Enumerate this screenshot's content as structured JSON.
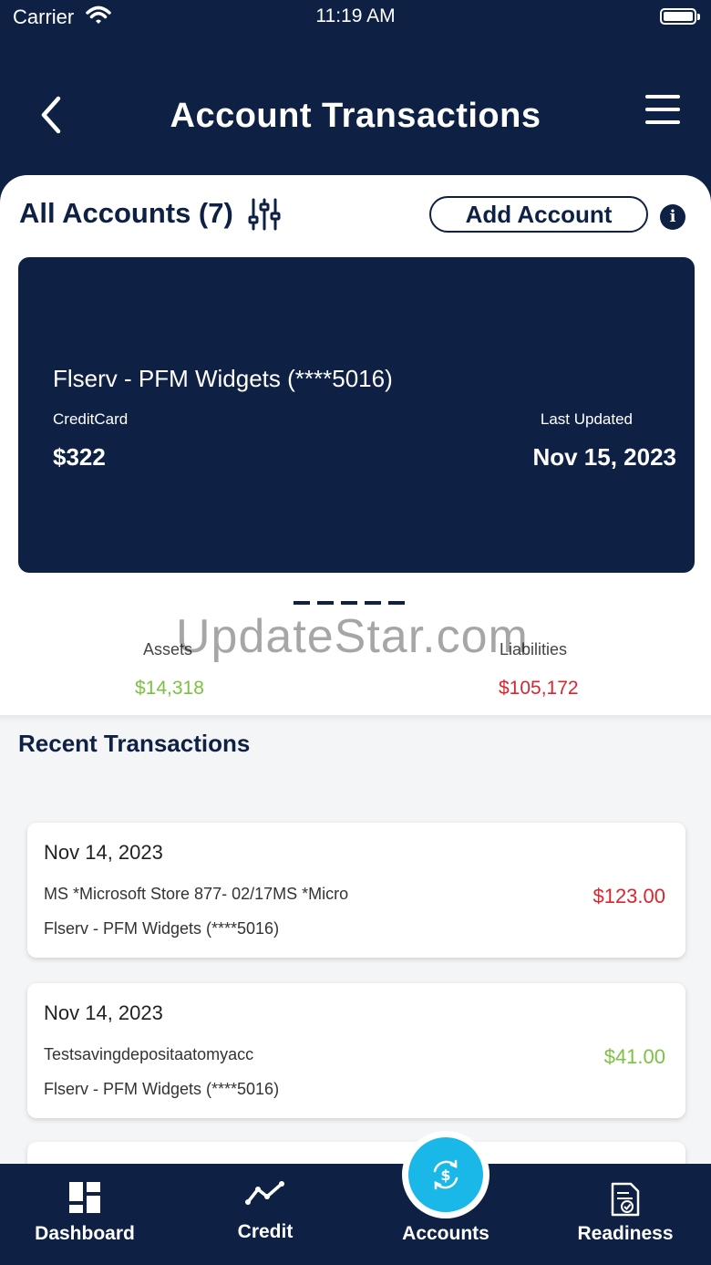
{
  "status_bar": {
    "carrier": "Carrier",
    "time": "11:19 AM"
  },
  "header": {
    "title": "Account Transactions"
  },
  "accounts": {
    "label": "All Accounts (7)",
    "add_button": "Add Account",
    "info": "i"
  },
  "card": {
    "name": "Flserv - PFM Widgets (****5016)",
    "type": "CreditCard",
    "balance": "$322",
    "last_updated_label": "Last Updated",
    "last_updated": "Nov 15, 2023"
  },
  "summary": {
    "assets_label": "Assets",
    "assets_value": "$14,318",
    "liabilities_label": "Liabilities",
    "liabilities_value": "$105,172"
  },
  "watermark": "UpdateStar.com",
  "recent": {
    "title": "Recent Transactions",
    "items": [
      {
        "date": "Nov 14, 2023",
        "description": "MS *Microsoft Store 877- 02/17MS *Micro",
        "account": "Flserv - PFM Widgets (****5016)",
        "amount": "$123.00"
      },
      {
        "date": "Nov 14, 2023",
        "description": "Testsavingdepositaatomyacc",
        "account": "Flserv - PFM Widgets (****5016)",
        "amount": "$41.00"
      }
    ]
  },
  "tabs": [
    "Dashboard",
    "Credit",
    "Accounts",
    "Readiness"
  ],
  "colors": {
    "navy": "#0e2144",
    "accent": "#1ab8e8",
    "positive": "#7cc142",
    "negative": "#d9262e"
  }
}
